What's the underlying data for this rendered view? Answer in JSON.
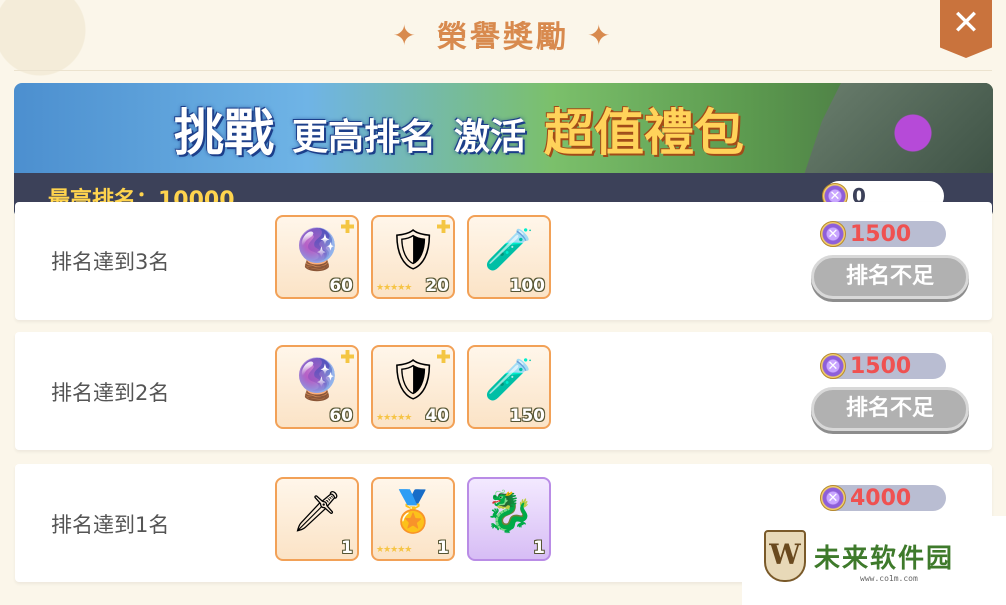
{
  "header": {
    "title": "榮譽獎勵",
    "close_symbol": "✕"
  },
  "banner": {
    "words": [
      "挑戰",
      "更高排名",
      "激活",
      "超值禮包"
    ],
    "best_rank_label": "最高排名：10000",
    "token_balance": "0"
  },
  "rows": [
    {
      "label": "排名達到3名",
      "items": [
        {
          "icon": "crystal-orb-icon",
          "glyph": "🔮",
          "count": "60",
          "stars": "",
          "corner": true
        },
        {
          "icon": "crest-fragment-icon",
          "glyph": "🛡",
          "count": "20",
          "stars": "★★★★★",
          "corner": true
        },
        {
          "icon": "potion-bottle-icon",
          "glyph": "🧪",
          "count": "100",
          "stars": "",
          "corner": false
        }
      ],
      "cost": "1500",
      "status": "排名不足"
    },
    {
      "label": "排名達到2名",
      "items": [
        {
          "icon": "crystal-orb-icon",
          "glyph": "🔮",
          "count": "60",
          "stars": "",
          "corner": true
        },
        {
          "icon": "crest-fragment-icon",
          "glyph": "🛡",
          "count": "40",
          "stars": "★★★★★",
          "corner": true
        },
        {
          "icon": "potion-bottle-icon",
          "glyph": "🧪",
          "count": "150",
          "stars": "",
          "corner": false
        }
      ],
      "cost": "1500",
      "status": "排名不足"
    },
    {
      "label": "排名達到1名",
      "items": [
        {
          "icon": "gauntlet-icon",
          "glyph": "🗡",
          "count": "1",
          "stars": "",
          "corner": false
        },
        {
          "icon": "crest-emblem-icon",
          "glyph": "🏅",
          "count": "1",
          "stars": "★★★★★",
          "corner": false
        },
        {
          "icon": "dragon-frame-icon",
          "glyph": "🐉",
          "count": "1",
          "stars": "",
          "corner": false
        }
      ],
      "cost": "4000",
      "status": ""
    }
  ],
  "watermark": {
    "text": "未来软件园",
    "url": "www.co1m.com",
    "letter": "W"
  }
}
